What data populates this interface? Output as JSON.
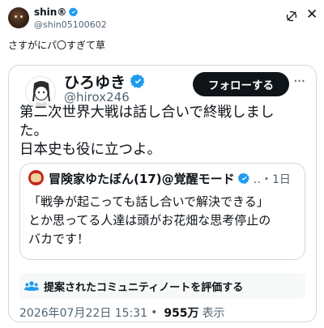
{
  "outer": {
    "display_name": "shin®",
    "handle": "@shin05100602",
    "text": "さすがにパ〇すぎて草"
  },
  "card": {
    "author": {
      "name": "ひろゆき",
      "handle": "@hirox246"
    },
    "follow_label": "フォローする",
    "text_lines": [
      "第二次世界大戦は話し合いで終戦しまし",
      "た。",
      "日本史も役に立つよ。"
    ],
    "quote": {
      "name": "冒険家ゆたぼん(17)@覚醒モード",
      "meta": "‥・1日",
      "text_lines": [
        "「戦争が起こっても話し合いで解決できる」",
        "とか思ってる人達は頭がお花畑な思考停止の",
        "バカです！"
      ]
    },
    "community_note_label": "提案されたコミュニティノートを評価する",
    "timestamp": "2026年07月22日 15:31",
    "separator": "•",
    "views": "955万",
    "views_label": "表示"
  },
  "colors": {
    "verified": "#1d9bf0",
    "text": "#0f1419",
    "secondary": "#536471",
    "border": "#cfd9de",
    "note_bg": "#f7f9f9"
  },
  "icons": {
    "verified": "verified-badge-icon",
    "grok": "grok-icon",
    "close": "close-icon",
    "more": "more-icon",
    "community": "community-notes-icon"
  }
}
